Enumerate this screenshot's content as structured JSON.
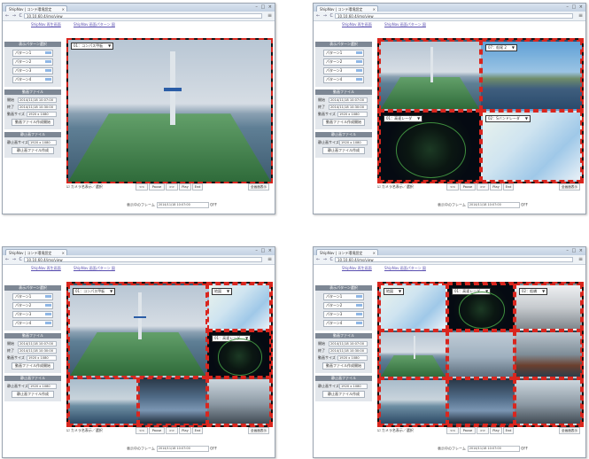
{
  "browser": {
    "tab_title": "ShipNav | コンテ環境設定",
    "tab_close": "×",
    "window_controls": "– □ ×",
    "nav": "← → C",
    "url": "10.10.60.4/ims/view",
    "menu": "≡"
  },
  "page": {
    "link_left": "ShipNav 再生画面",
    "link_right": "ShipNav 画面パターン 図"
  },
  "sidebar": {
    "pattern_header": "表示パターン選択",
    "patterns": [
      "パターン1",
      "パターン2",
      "パターン3",
      "パターン4"
    ],
    "file_header": "動画ファイル",
    "start_label": "開始",
    "start_value": "2014/11/18 10:07:00",
    "end_label": "終了",
    "end_value": "2014/11/18 10:30:00",
    "size_label": "動画サイズ",
    "size_value": "1920 x 1080",
    "download_button": "動画ファイル作成開始",
    "still_header": "静止画ファイル",
    "still_size_label": "静止画サイズ",
    "still_size_value": "1920 x 1080",
    "still_button": "静止画ファイル作成"
  },
  "panels": {
    "p1": {
      "cam1": "01：コンパス甲板"
    },
    "p2": {
      "cam1": "07：船尾 2",
      "cam2": "01：高速レーダ",
      "cam3": "02：Sバンドレーダ"
    },
    "p3": {
      "cam1": "01：コンパス甲板",
      "cam2": "地図",
      "cam3": "01：高速レーダ"
    },
    "p4": {
      "cam1": "地図",
      "cam2": "01：高速レーダ",
      "cam3": "02：船橋"
    }
  },
  "controls": {
    "toggle_label": "カメラ名表示／選択",
    "buttons": [
      "<<",
      "Pause",
      ">>",
      "Play",
      "End"
    ],
    "full": "全画面表示",
    "frame_label": "表示中のフレーム",
    "frame_value": "2014/11/18 10:07:00",
    "frame_suffix": "OFF"
  }
}
